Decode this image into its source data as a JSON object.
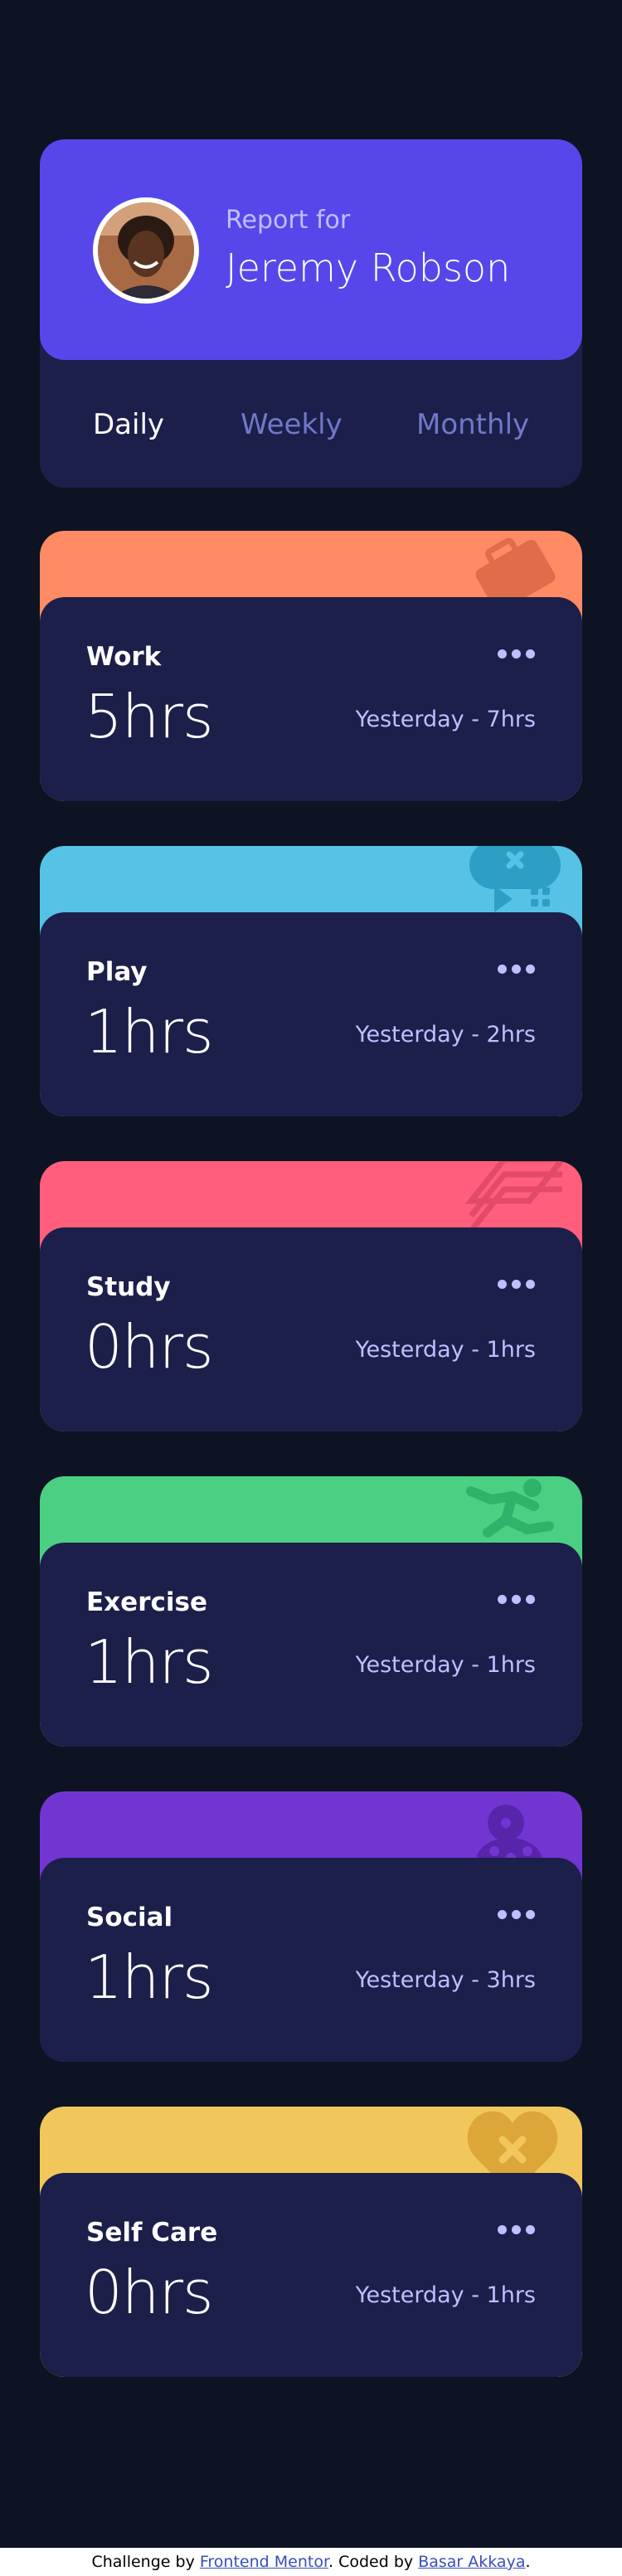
{
  "profile": {
    "report_label": "Report for",
    "name": "Jeremy Robson",
    "periods": [
      {
        "label": "Daily",
        "active": true
      },
      {
        "label": "Weekly",
        "active": false
      },
      {
        "label": "Monthly",
        "active": false
      }
    ]
  },
  "activities": [
    {
      "title": "Work",
      "hours": "5hrs",
      "previous": "Yesterday - 7hrs",
      "color": "#ff8b64",
      "icon": "briefcase-icon"
    },
    {
      "title": "Play",
      "hours": "1hrs",
      "previous": "Yesterday - 2hrs",
      "color": "#55c2e6",
      "icon": "gamepad-icon"
    },
    {
      "title": "Study",
      "hours": "0hrs",
      "previous": "Yesterday - 1hrs",
      "color": "#ff5e7d",
      "icon": "book-icon"
    },
    {
      "title": "Exercise",
      "hours": "1hrs",
      "previous": "Yesterday - 1hrs",
      "color": "#4bcf82",
      "icon": "running-icon"
    },
    {
      "title": "Social",
      "hours": "1hrs",
      "previous": "Yesterday - 3hrs",
      "color": "#7335d2",
      "icon": "social-icon"
    },
    {
      "title": "Self Care",
      "hours": "0hrs",
      "previous": "Yesterday - 1hrs",
      "color": "#f1c75b",
      "icon": "heart-icon"
    }
  ],
  "footer": {
    "prefix": "Challenge by ",
    "link1": "Frontend Mentor",
    "middle": ". Coded by ",
    "link2": "Basar Akkaya",
    "suffix": "."
  }
}
